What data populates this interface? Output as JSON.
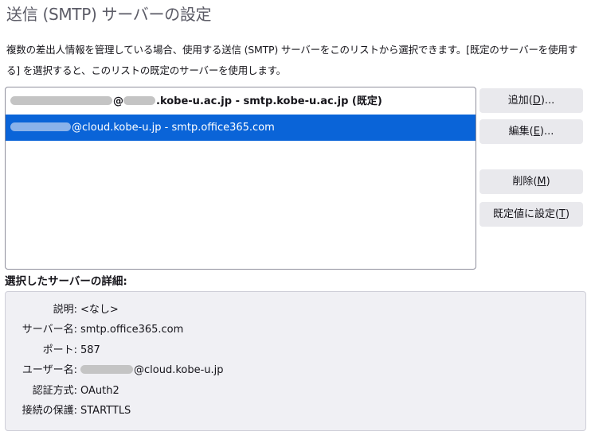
{
  "title": "送信 (SMTP) サーバーの設定",
  "description": "複数の差出人情報を管理している場合、使用する送信 (SMTP) サーバーをこのリストから選択できます。[既定のサーバーを使用する] を選択すると、このリストの既定のサーバーを使用します。",
  "servers": [
    {
      "username_suffix": "@",
      "host_suffix": ".kobe-u.ac.jp",
      "separator": " - ",
      "server": "smtp.kobe-u.ac.jp",
      "default_tag": " (既定)",
      "is_default": true,
      "selected": false
    },
    {
      "username_suffix": "@cloud.kobe-u.jp",
      "separator": " - ",
      "server": "smtp.office365.com",
      "is_default": false,
      "selected": true
    }
  ],
  "buttons": {
    "add": {
      "label": "追加(",
      "access_key": "D",
      "suffix": ")..."
    },
    "edit": {
      "label": "編集(",
      "access_key": "E",
      "suffix": ")..."
    },
    "remove": {
      "label": "削除(",
      "access_key": "M",
      "suffix": ")"
    },
    "set_default": {
      "label": "既定値に設定(",
      "access_key": "T",
      "suffix": ")"
    }
  },
  "details": {
    "title": "選択したサーバーの詳細:",
    "description_label": "説明:",
    "description_value": "<なし>",
    "server_name_label": "サーバー名:",
    "server_name_value": "smtp.office365.com",
    "port_label": "ポート:",
    "port_value": "587",
    "username_label": "ユーザー名:",
    "username_value_suffix": "@cloud.kobe-u.jp",
    "auth_label": "認証方式:",
    "auth_value": "OAuth2",
    "security_label": "接続の保護:",
    "security_value": "STARTTLS"
  },
  "colors": {
    "selection": "#0a64d8",
    "button_bg": "#e9e9ed",
    "details_bg": "#f0f0f4",
    "title_text": "#5b5b66"
  }
}
